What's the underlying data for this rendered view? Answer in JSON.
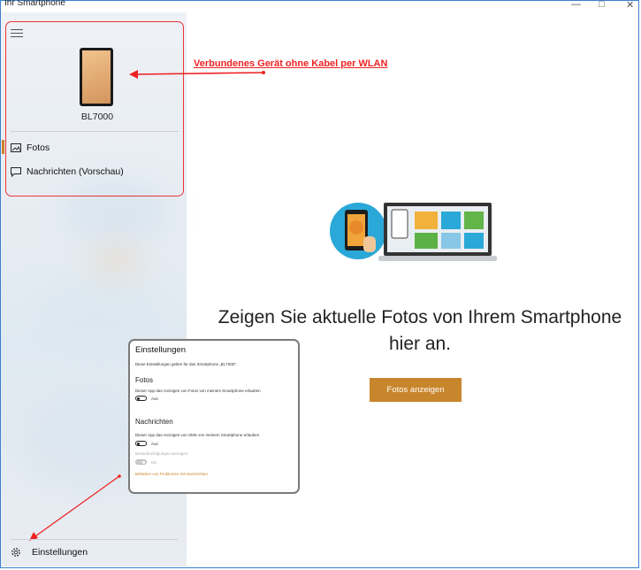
{
  "window": {
    "title": "Ihr Smartphone",
    "minimize_glyph": "—",
    "maximize_glyph": "□",
    "close_glyph": "✕"
  },
  "sidebar": {
    "device_name": "BL7000",
    "nav": [
      {
        "label": "Fotos",
        "icon": "photo-icon",
        "active": true
      },
      {
        "label": "Nachrichten (Vorschau)",
        "icon": "message-icon",
        "active": false
      }
    ],
    "settings_label": "Einstellungen",
    "settings_icon": "gear-icon"
  },
  "annotation": {
    "text": "Verbundenes Gerät ohne Kabel per WLAN",
    "color": "#e22222"
  },
  "main": {
    "heading_line1": "Zeigen Sie aktuelle Fotos von Ihrem Smartphone",
    "heading_line2": "hier an.",
    "button_label": "Fotos anzeigen",
    "accent": "#c8862c"
  },
  "settings_card": {
    "title": "Einstellungen",
    "subtitle": "Diese Einstellungen gelten für das Smartphone „BL7000\".",
    "photos_heading": "Fotos",
    "photos_desc": "Dieser App das Anzeigen von Fotos von meinem Smartphone erlauben",
    "photos_toggle": "Aus",
    "messages_heading": "Nachrichten",
    "messages_desc": "Dieser App das Anzeigen von SMS von meinem Smartphone erlauben",
    "messages_toggle": "Aus",
    "notifications_label": "Benachrichtigungen anzeigen",
    "notifications_toggle": "Ein",
    "troubleshoot_link": "Beheben von Problemen mit Nachrichten"
  }
}
